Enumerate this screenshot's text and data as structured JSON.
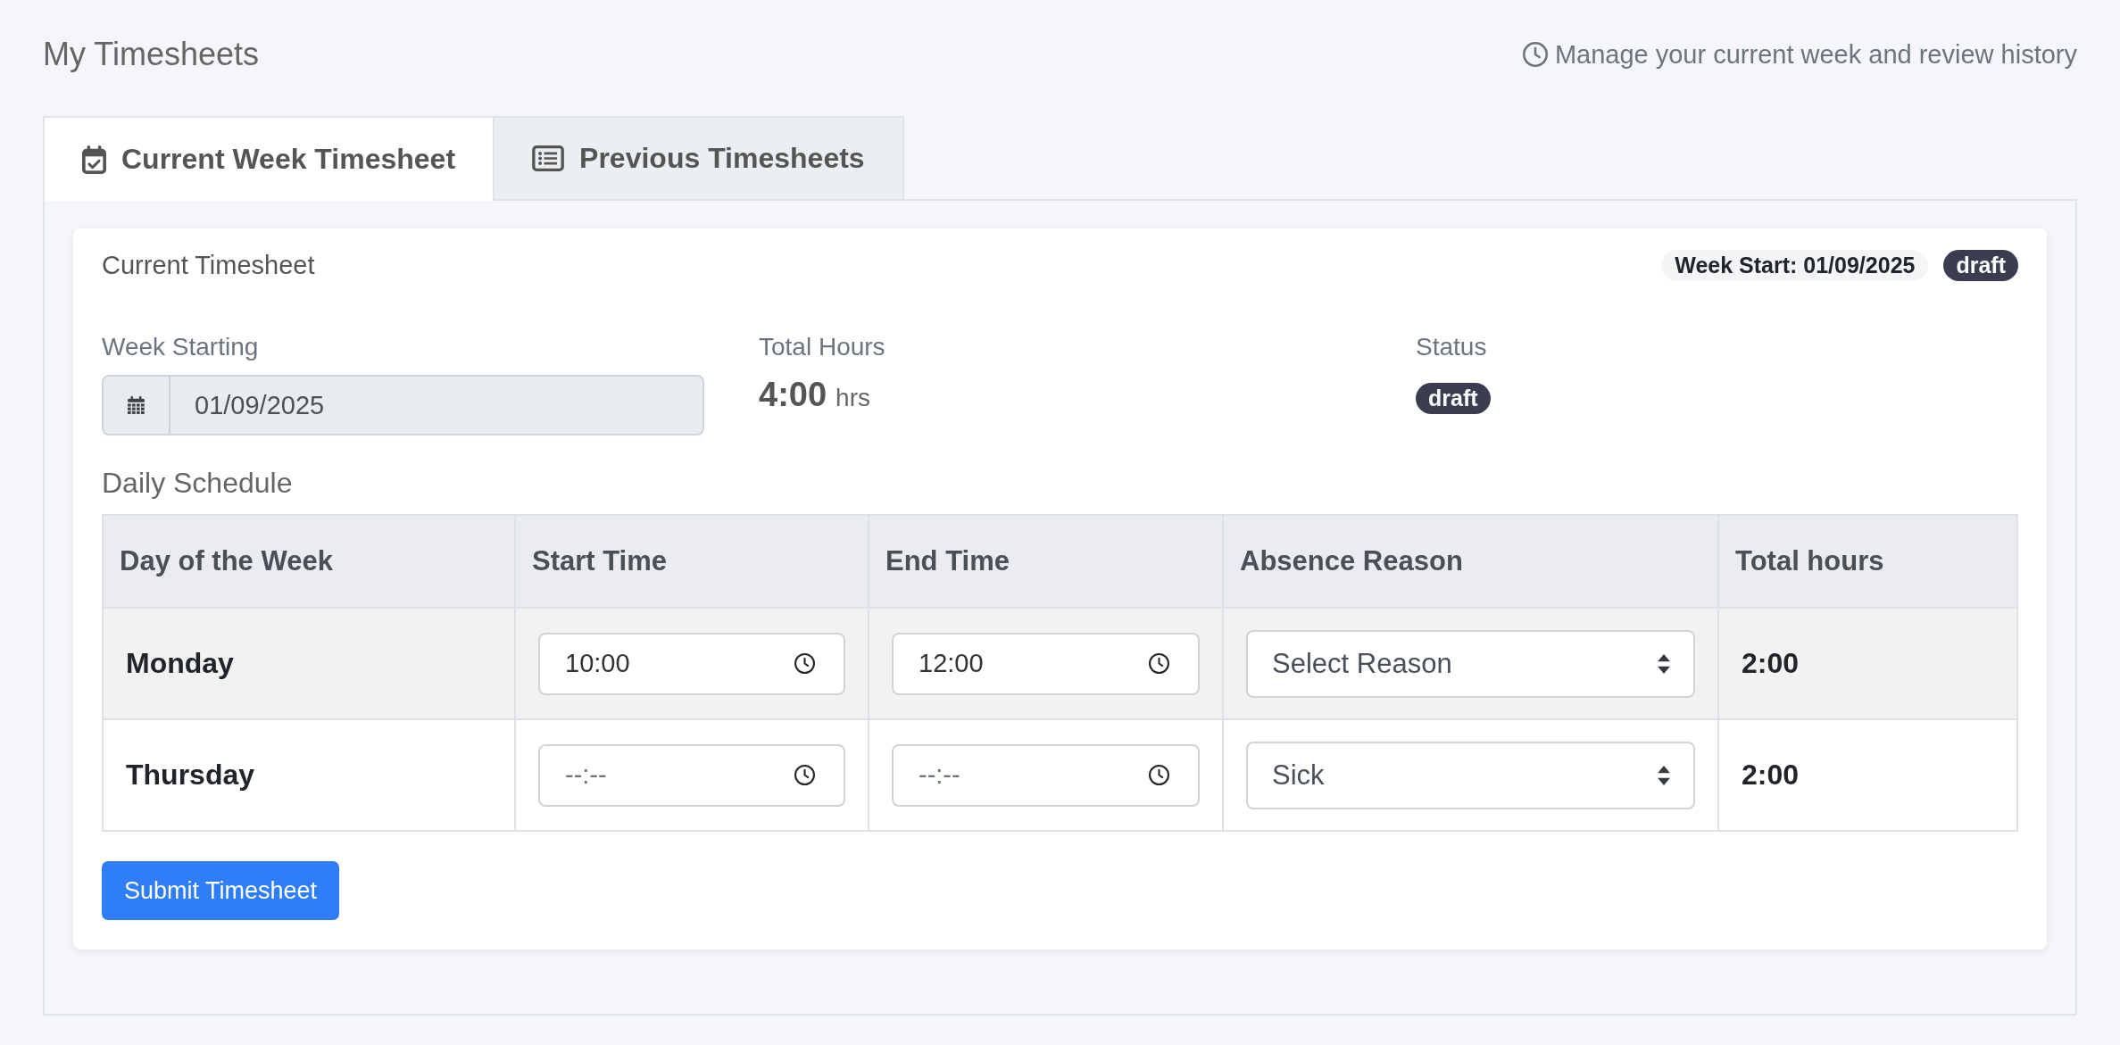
{
  "header": {
    "title": "My Timesheets",
    "subtitle": "Manage your current week and review history"
  },
  "tabs": [
    {
      "label": "Current Week Timesheet",
      "selected": true
    },
    {
      "label": "Previous Timesheets",
      "selected": false
    }
  ],
  "card": {
    "title": "Current Timesheet",
    "badges": [
      {
        "text": "Week Start: 01/09/2025",
        "kind": "light"
      },
      {
        "text": "draft",
        "kind": "dark"
      }
    ]
  },
  "summary": {
    "week_starting": {
      "label": "Week Starting",
      "value": "01/09/2025"
    },
    "total_hours": {
      "label": "Total Hours",
      "value": "4:00",
      "unit": "hrs"
    },
    "status": {
      "label": "Status",
      "value": "draft"
    }
  },
  "schedule": {
    "title": "Daily Schedule",
    "columns": [
      "Day of the Week",
      "Start Time",
      "End Time",
      "Absence Reason",
      "Total hours"
    ],
    "rows": [
      {
        "day": "Monday",
        "start_time": {
          "value": "10:00"
        },
        "end_time": {
          "value": "12:00"
        },
        "absence_reason": "Select Reason",
        "total": "2:00"
      },
      {
        "day": "Thursday",
        "start_time": {
          "placeholder": "--:--"
        },
        "end_time": {
          "placeholder": "--:--"
        },
        "absence_reason": "Sick",
        "total": "2:00"
      }
    ]
  },
  "submit_button": "Submit Timesheet"
}
